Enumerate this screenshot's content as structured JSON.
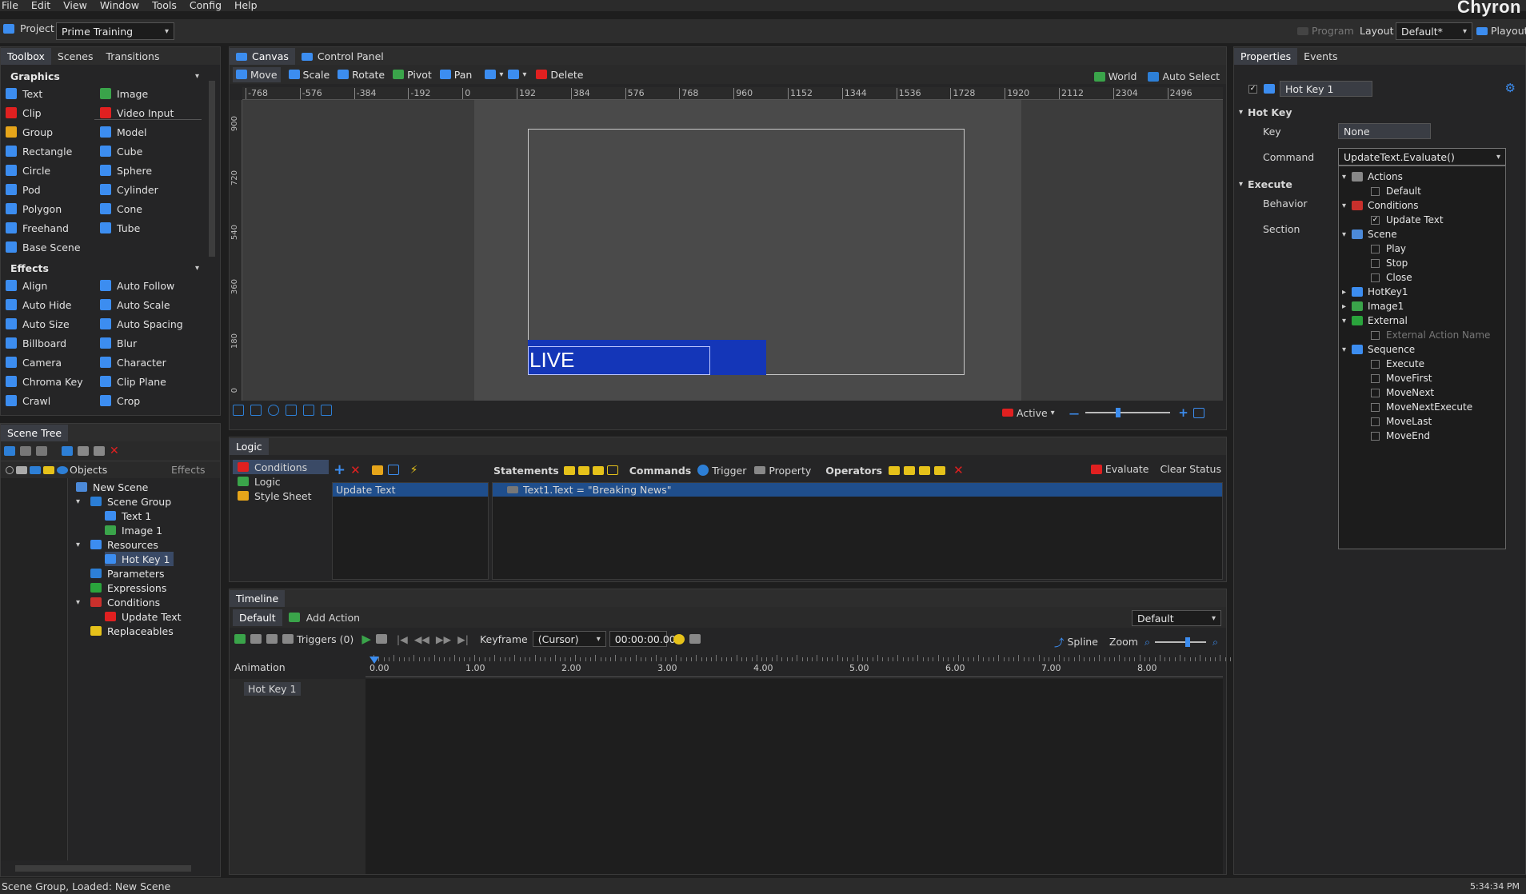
{
  "menu": [
    "File",
    "Edit",
    "View",
    "Window",
    "Tools",
    "Config",
    "Help"
  ],
  "brand": "Chyron",
  "projectbar": {
    "project_label": "Project",
    "project_value": "Prime Training",
    "program_label": "Program",
    "layout_label": "Layout",
    "layout_value": "Default*",
    "playout_label": "Playout"
  },
  "left_tabs": [
    "Toolbox",
    "Scenes",
    "Transitions"
  ],
  "graphics": {
    "title": "Graphics",
    "col1": [
      "Text",
      "Clip",
      "Group",
      "Rectangle",
      "Circle",
      "Pod",
      "Polygon",
      "Freehand",
      "Base Scene"
    ],
    "col2": [
      "Image",
      "Video Input",
      "Model",
      "Cube",
      "Sphere",
      "Cylinder",
      "Cone",
      "Tube"
    ]
  },
  "effects": {
    "title": "Effects",
    "col1": [
      "Align",
      "Auto Hide",
      "Auto Size",
      "Billboard",
      "Camera",
      "Chroma Key",
      "Crawl"
    ],
    "col2": [
      "Auto Follow",
      "Auto Scale",
      "Auto Spacing",
      "Blur",
      "Character",
      "Clip Plane",
      "Crop"
    ]
  },
  "scene_tree": {
    "tab": "Scene Tree",
    "col_objects": "Objects",
    "col_effects": "Effects",
    "items": [
      {
        "label": "New Scene",
        "indent": 0,
        "icon": "scene-icon",
        "color": "#4c8ad9"
      },
      {
        "label": "Scene Group",
        "indent": 1,
        "exp": "v",
        "icon": "folder-icon",
        "color": "#2b7ed6"
      },
      {
        "label": "Text 1",
        "indent": 2,
        "icon": "text-icon",
        "color": "#3c8df0"
      },
      {
        "label": "Image 1",
        "indent": 2,
        "icon": "image-icon",
        "color": "#3aa44a"
      },
      {
        "label": "Resources",
        "indent": 1,
        "exp": "v",
        "icon": "resources-icon",
        "color": "#3c8df0"
      },
      {
        "label": "Hot Key 1",
        "indent": 2,
        "icon": "hotkey-icon",
        "color": "#3c8df0",
        "selected": true
      },
      {
        "label": "Parameters",
        "indent": 1,
        "icon": "parameters-icon",
        "color": "#2d7fd6"
      },
      {
        "label": "Expressions",
        "indent": 1,
        "icon": "expressions-icon",
        "color": "#2aa43c"
      },
      {
        "label": "Conditions",
        "indent": 1,
        "exp": "v",
        "icon": "conditions-icon",
        "color": "#c9302c"
      },
      {
        "label": "Update Text",
        "indent": 2,
        "icon": "condition-icon",
        "color": "#e02020"
      },
      {
        "label": "Replaceables",
        "indent": 1,
        "icon": "replaceables-icon",
        "color": "#e6c21a"
      }
    ]
  },
  "canvas": {
    "tabs": [
      "Canvas",
      "Control Panel"
    ],
    "tools": [
      "Move",
      "Scale",
      "Rotate",
      "Pivot",
      "Pan",
      "Delete"
    ],
    "world": "World",
    "auto_select": "Auto Select",
    "h_ruler": [
      "-768",
      "-576",
      "-384",
      "-192",
      "0",
      "192",
      "384",
      "576",
      "768",
      "960",
      "1152",
      "1344",
      "1536",
      "1728",
      "1920",
      "2112",
      "2304",
      "2496"
    ],
    "v_ruler": [
      "900",
      "720",
      "540",
      "360",
      "180",
      "0"
    ],
    "live_text": "LIVE",
    "active": "Active"
  },
  "logic": {
    "tab": "Logic",
    "nav": [
      "Conditions",
      "Logic",
      "Style Sheet"
    ],
    "statements": "Statements",
    "commands": "Commands",
    "trigger": "Trigger",
    "property": "Property",
    "operators": "Operators",
    "evaluate": "Evaluate",
    "clear_status": "Clear Status",
    "condition_item": "Update Text",
    "statement_row": "Text1.Text = \"Breaking News\""
  },
  "timeline": {
    "tab": "Timeline",
    "default_tab": "Default",
    "add_action": "Add Action",
    "select": "Default",
    "triggers": "Triggers (0)",
    "keyframe_label": "Keyframe",
    "keyframe_value": "(Cursor)",
    "time": "00:00:00.00",
    "spline": "Spline",
    "zoom": "Zoom",
    "animation": "Animation",
    "ticks": [
      "0.00",
      "1.00",
      "2.00",
      "3.00",
      "4.00",
      "5.00",
      "6.00",
      "7.00",
      "8.00"
    ],
    "track": "Hot Key 1"
  },
  "props": {
    "tabs": [
      "Properties",
      "Events"
    ],
    "name": "Hot Key 1",
    "hotkey_section": "Hot Key",
    "key_label": "Key",
    "key_value": "None",
    "command_label": "Command",
    "command_value": "UpdateText.Evaluate()",
    "execute_section": "Execute",
    "behavior_label": "Behavior",
    "section_label": "Section"
  },
  "dropdown": [
    {
      "label": "Actions",
      "type": "group",
      "exp": "v",
      "color": "#888"
    },
    {
      "label": "Default",
      "type": "item",
      "checked": false
    },
    {
      "label": "Conditions",
      "type": "group",
      "exp": "v",
      "color": "#c9302c"
    },
    {
      "label": "Update Text",
      "type": "item",
      "checked": true
    },
    {
      "label": "Scene",
      "type": "group",
      "exp": "v",
      "color": "#4c8ad9"
    },
    {
      "label": "Play",
      "type": "item",
      "checked": false
    },
    {
      "label": "Stop",
      "type": "item",
      "checked": false
    },
    {
      "label": "Close",
      "type": "item",
      "checked": false
    },
    {
      "label": "HotKey1",
      "type": "group",
      "exp": ">",
      "color": "#3c8df0"
    },
    {
      "label": "Image1",
      "type": "group",
      "exp": ">",
      "color": "#3aa44a"
    },
    {
      "label": "External",
      "type": "group",
      "exp": "v",
      "color": "#2aa43c"
    },
    {
      "label": "External Action Name",
      "type": "item",
      "checked": false,
      "disabled": true
    },
    {
      "label": "Sequence",
      "type": "group",
      "exp": "v",
      "color": "#3c8df0"
    },
    {
      "label": "Execute",
      "type": "item",
      "checked": false
    },
    {
      "label": "MoveFirst",
      "type": "item",
      "checked": false
    },
    {
      "label": "MoveNext",
      "type": "item",
      "checked": false
    },
    {
      "label": "MoveNextExecute",
      "type": "item",
      "checked": false
    },
    {
      "label": "MoveLast",
      "type": "item",
      "checked": false
    },
    {
      "label": "MoveEnd",
      "type": "item",
      "checked": false
    }
  ],
  "status": {
    "left": "Scene Group, Loaded: New Scene",
    "right": "5:34:34 PM"
  }
}
